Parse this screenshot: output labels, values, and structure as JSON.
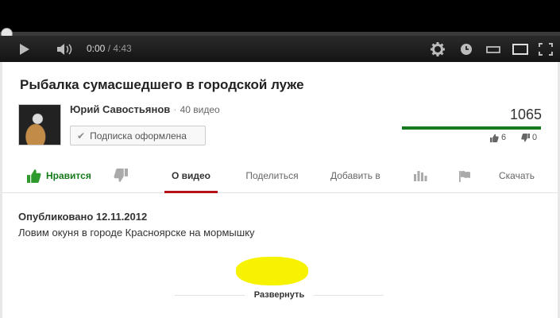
{
  "player": {
    "current_time": "0:00",
    "duration": "/ 4:43",
    "progress_fraction": 0.0,
    "icons": [
      "play-icon",
      "volume-icon",
      "settings-icon",
      "watch-later-icon",
      "small-player-icon",
      "large-player-icon",
      "fullscreen-icon"
    ]
  },
  "video": {
    "title": "Рыбалка сумасшедшего в городской луже",
    "channel_name": "Юрий Савостьянов",
    "separator": "·",
    "video_count": "40 видео",
    "subscribe_label": "Подписка оформлена",
    "views": "1065",
    "likes": "6",
    "dislikes": "0",
    "like_ratio": 1.0
  },
  "actions": {
    "like_label": "Нравится",
    "about_label": "О видео",
    "share_label": "Поделиться",
    "add_label": "Добавить в",
    "download_label": "Скачать"
  },
  "description": {
    "published": "Опубликовано 12.11.2012",
    "text": "Ловим окуня в городе Красноярске на мормышку",
    "expand_label": "Развернуть"
  },
  "colors": {
    "accent_red": "#b31217",
    "like_green": "#167a1c",
    "highlight_yellow": "#f7f200"
  }
}
